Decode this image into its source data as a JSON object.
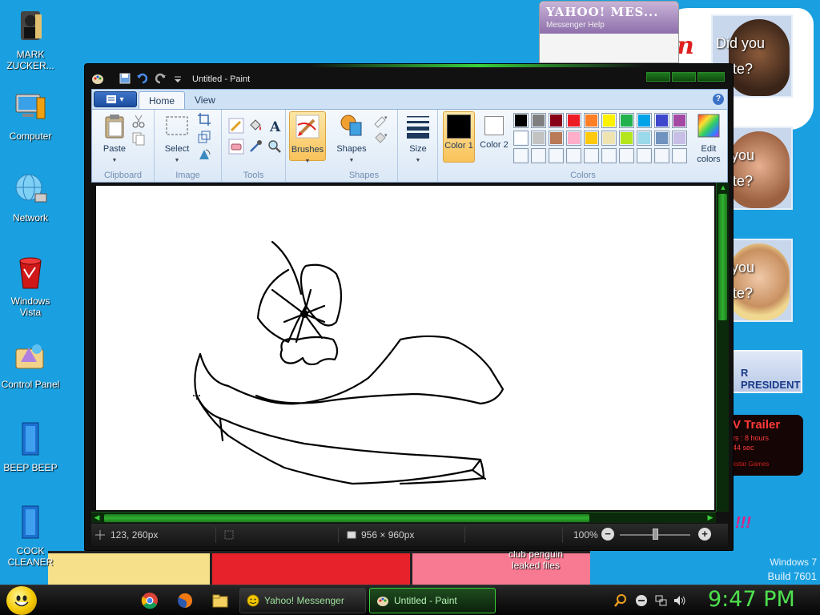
{
  "desktop": {
    "icons": [
      {
        "label": "MARK ZUCKER..."
      },
      {
        "label": "Computer"
      },
      {
        "label": "Network"
      },
      {
        "label": "Windows Vista"
      },
      {
        "label": "Control Panel"
      },
      {
        "label": "BEEP BEEP"
      },
      {
        "label": "COCK CLEANER"
      }
    ],
    "yahoo": {
      "logo": "YAHOO! MES...",
      "menu": "Messenger   Help"
    },
    "vote_cards": [
      {
        "text_line1": "Did you",
        "text_line2": "Vote?"
      },
      {
        "text_line1": "id you",
        "text_line2": "Vote?"
      },
      {
        "text_line1": "id you",
        "text_line2": "Vote?"
      }
    ],
    "red_letters": "n t",
    "president_label": "R PRESIDENT",
    "trailer": {
      "title": "V Trailer",
      "line1": "rs : 8 hours",
      "line2": "44 sec",
      "footer": "kstar Games"
    },
    "exclaims": "!!!",
    "club_penguin": "club penguin leaked files",
    "windows_version": {
      "line1": "Windows 7",
      "line2": "Build 7601"
    }
  },
  "paint": {
    "title": "Untitled - Paint",
    "tabs": [
      "Home",
      "View"
    ],
    "active_tab": "Home",
    "groups": {
      "clipboard": {
        "label": "Clipboard",
        "paste": "Paste"
      },
      "image": {
        "label": "Image",
        "select": "Select"
      },
      "tools": {
        "label": "Tools"
      },
      "brushes": {
        "label": "Brushes"
      },
      "shapes": {
        "label": "Shapes",
        "button": "Shapes"
      },
      "size": {
        "label": "Size"
      },
      "colors": {
        "label": "Colors",
        "color1": "Color 1",
        "color2": "Color 2",
        "edit": "Edit colors",
        "color1_value": "#000000",
        "color2_value": "#ffffff",
        "palette": [
          "#000000",
          "#7f7f7f",
          "#880015",
          "#ed1c24",
          "#ff7f27",
          "#fff200",
          "#22b14c",
          "#00a2e8",
          "#3f48cc",
          "#a349a4",
          "#ffffff",
          "#c3c3c3",
          "#b97a57",
          "#ffaec9",
          "#ffc90e",
          "#efe4b0",
          "#b5e61d",
          "#99d9ea",
          "#7092be",
          "#c8bfe7",
          "#f4f8fd",
          "#f4f8fd",
          "#f4f8fd",
          "#f4f8fd",
          "#f4f8fd",
          "#f4f8fd",
          "#f4f8fd",
          "#f4f8fd",
          "#f4f8fd",
          "#f4f8fd"
        ]
      }
    },
    "status": {
      "cursor_pos": "123, 260px",
      "canvas_size": "956 × 960px",
      "zoom": "100%"
    }
  },
  "taskbar": {
    "tasks": [
      {
        "label": "Yahoo! Messenger"
      },
      {
        "label": "Untitled - Paint"
      }
    ],
    "clock": "9:47 PM"
  }
}
